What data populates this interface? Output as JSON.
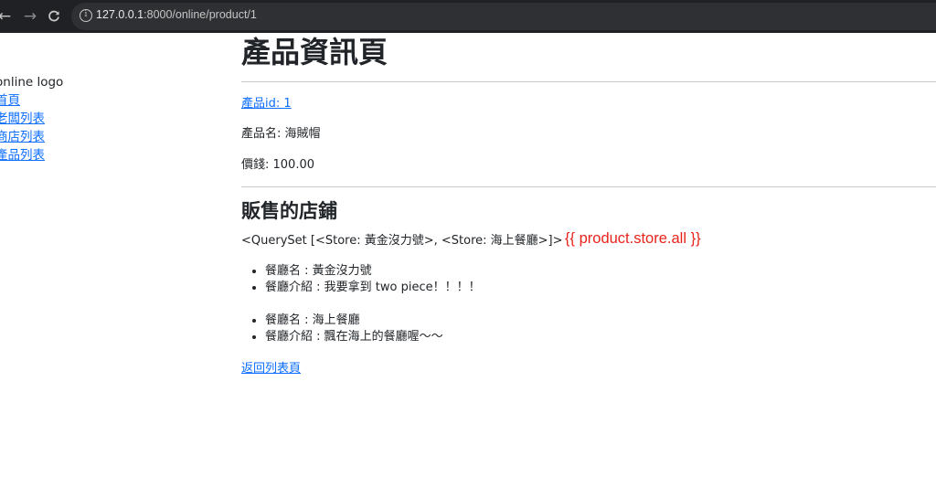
{
  "browser": {
    "back_glyph": "←",
    "forward_glyph": "→",
    "reload_glyph": "↻",
    "url_host": "127.0.0.1",
    "url_rest": ":8000/online/product/1"
  },
  "sidebar": {
    "logo": "online logo",
    "links": [
      "首頁",
      "老闆列表",
      "商店列表",
      "產品列表"
    ]
  },
  "main": {
    "title": "產品資訊頁",
    "product_id_link": "產品id: 1",
    "product_name": "產品名: 海賊帽",
    "price": "價錢: 100.00",
    "stores_heading": "販售的店鋪",
    "queryset_text": "<QuerySet [<Store: 黃金沒力號>, <Store: 海上餐廳>]>",
    "template_annotation": "{{ product.store.all }}",
    "stores": [
      {
        "name": "餐廳名 : 黃金沒力號",
        "intro": "餐廳介紹 : 我要拿到 two piece！！！！"
      },
      {
        "name": "餐廳名 : 海上餐廳",
        "intro": "餐廳介紹 : 飄在海上的餐廳喔～～"
      }
    ],
    "back_link": "返回列表頁"
  },
  "colors": {
    "link": "#0d6efd",
    "annotation": "#e8231b",
    "chrome_bg": "#202124"
  }
}
